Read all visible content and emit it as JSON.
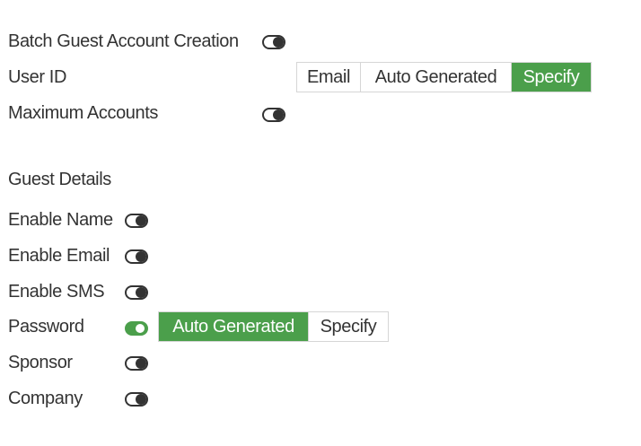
{
  "form": {
    "batch_creation": {
      "label": "Batch Guest Account Creation",
      "enabled": false
    },
    "user_id": {
      "label": "User ID",
      "options": [
        "Email",
        "Auto Generated",
        "Specify"
      ],
      "selected": "Specify"
    },
    "maximum_accounts": {
      "label": "Maximum Accounts",
      "enabled": false
    },
    "guest_details": {
      "heading": "Guest Details",
      "enable_name": {
        "label": "Enable Name",
        "enabled": false
      },
      "enable_email": {
        "label": "Enable Email",
        "enabled": false
      },
      "enable_sms": {
        "label": "Enable SMS",
        "enabled": false
      },
      "password": {
        "label": "Password",
        "enabled": true,
        "options": [
          "Auto Generated",
          "Specify"
        ],
        "selected": "Auto Generated"
      },
      "sponsor": {
        "label": "Sponsor",
        "enabled": false
      },
      "company": {
        "label": "Company",
        "enabled": false
      }
    }
  },
  "colors": {
    "accent_green": "#4b9f4b",
    "text": "#333333",
    "border": "#d6d6d6"
  },
  "icons": {
    "toggle_off": "toggle-off-icon",
    "toggle_on": "toggle-on-icon"
  }
}
